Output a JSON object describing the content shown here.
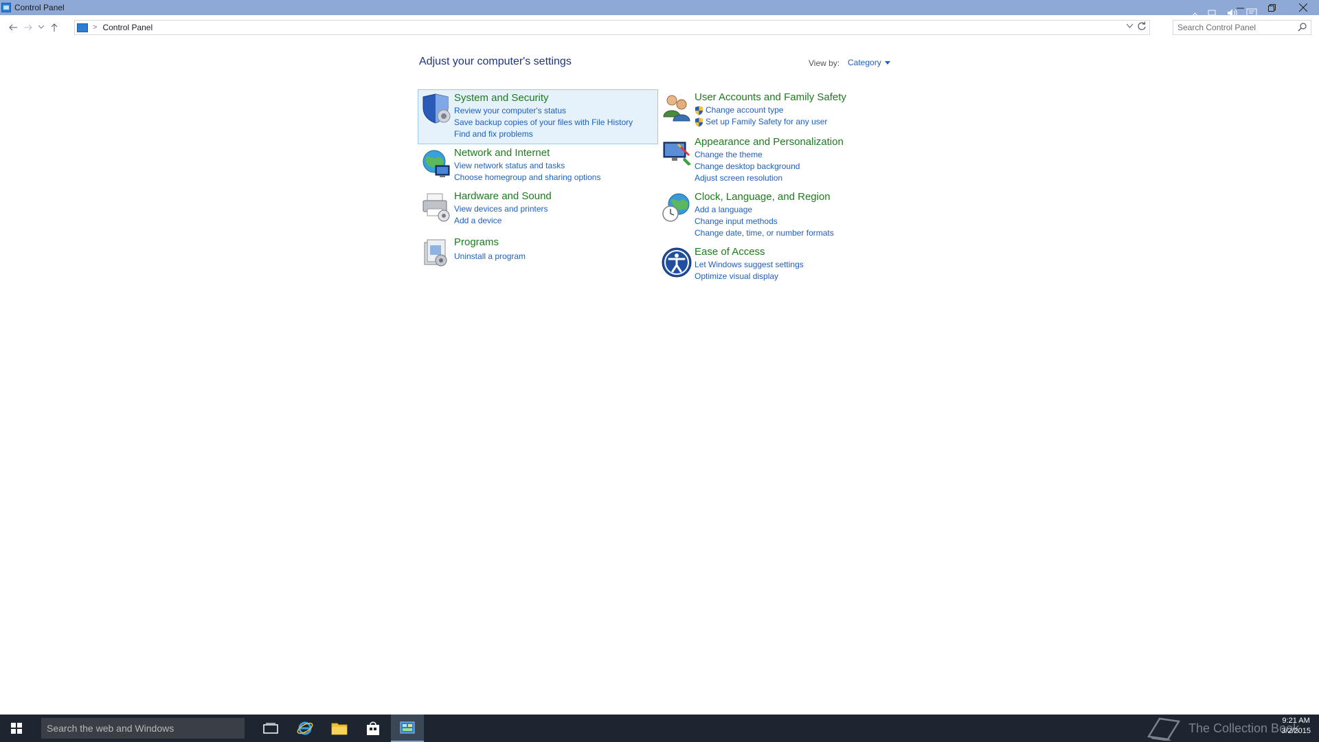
{
  "window": {
    "title": "Control Panel"
  },
  "address": {
    "crumb": "Control Panel",
    "search_placeholder": "Search Control Panel"
  },
  "main": {
    "heading": "Adjust your computer's settings",
    "view_by_label": "View by:",
    "view_by_value": "Category"
  },
  "categories": [
    {
      "title": "System and Security",
      "icon": "shield-icon",
      "links": [
        "Review your computer's status",
        "Save backup copies of your files with File History",
        "Find and fix problems"
      ]
    },
    {
      "title": "Network and Internet",
      "icon": "globe-network-icon",
      "links": [
        "View network status and tasks",
        "Choose homegroup and sharing options"
      ]
    },
    {
      "title": "Hardware and Sound",
      "icon": "printer-icon",
      "links": [
        "View devices and printers",
        "Add a device"
      ]
    },
    {
      "title": "Programs",
      "icon": "programs-icon",
      "links": [
        "Uninstall a program"
      ]
    },
    {
      "title": "User Accounts and Family Safety",
      "icon": "users-icon",
      "links": [
        "Change account type",
        "Set up Family Safety for any user"
      ]
    },
    {
      "title": "Appearance and Personalization",
      "icon": "appearance-icon",
      "links": [
        "Change the theme",
        "Change desktop background",
        "Adjust screen resolution"
      ]
    },
    {
      "title": "Clock, Language, and Region",
      "icon": "clock-globe-icon",
      "links": [
        "Add a language",
        "Change input methods",
        "Change date, time, or number formats"
      ]
    },
    {
      "title": "Ease of Access",
      "icon": "ease-of-access-icon",
      "links": [
        "Let Windows suggest settings",
        "Optimize visual display"
      ]
    }
  ],
  "taskbar": {
    "search_placeholder": "Search the web and Windows",
    "watermark": "The Collection Book",
    "time": "9:21 AM",
    "date": "3/2/2015"
  }
}
